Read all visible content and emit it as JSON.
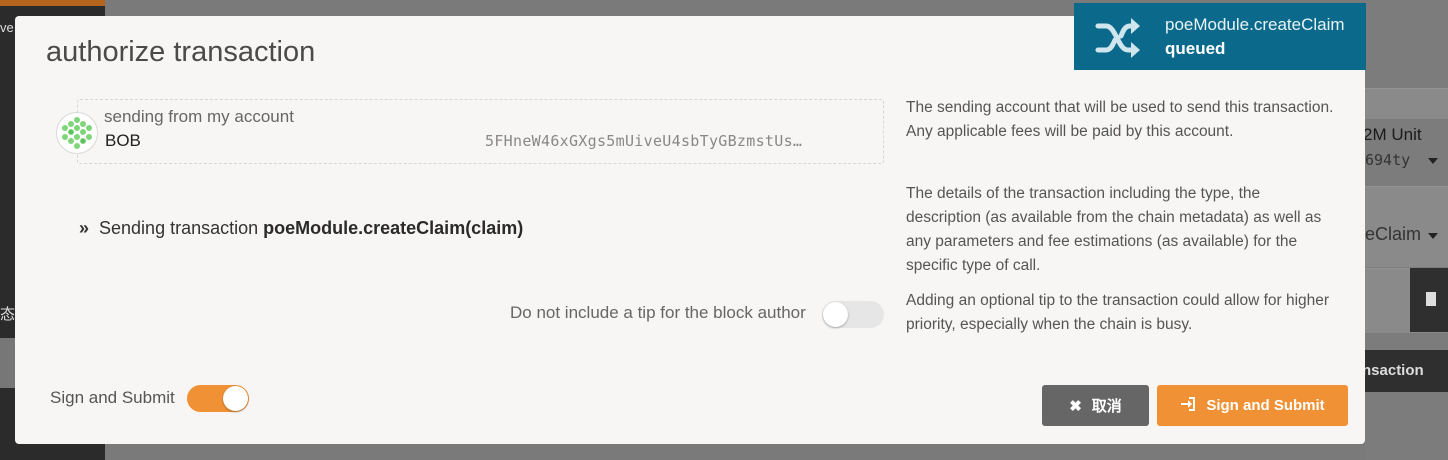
{
  "background": {
    "sidebar_text_top": "ve",
    "sidebar_text_mid": "态",
    "card_unit": "2M Unit",
    "card_address": "694ty",
    "card_selected": "eClaim",
    "action_button": "nsaction"
  },
  "modal": {
    "title": "authorize transaction",
    "account": {
      "label": "sending from my account",
      "name": "BOB",
      "address": "5FHneW46xGXgs5mUiveU4sbTyGBzmstUs…"
    },
    "help": {
      "account": "The sending account that will be used to send this transaction. Any applicable fees will be paid by this account.",
      "details": "The details of the transaction including the type, the description (as available from the chain metadata) as well as any parameters and fee estimations (as available) for the specific type of call.",
      "tip": "Adding an optional tip to the transaction could allow for higher priority, especially when the chain is busy."
    },
    "transaction": {
      "prefix": "Sending transaction",
      "call": "poeModule.createClaim(claim)"
    },
    "tip_toggle": {
      "label": "Do not include a tip for the block author",
      "on": false
    },
    "sign_toggle": {
      "label": "Sign and Submit",
      "on": true
    },
    "buttons": {
      "cancel": "取消",
      "submit": "Sign and Submit"
    }
  },
  "notification": {
    "icon": "shuffle-icon",
    "title": "poeModule.createClaim",
    "status": "queued"
  },
  "colors": {
    "accent": "#f19135",
    "notification_bg": "#0b6a8c",
    "cancel_bg": "#666666"
  }
}
